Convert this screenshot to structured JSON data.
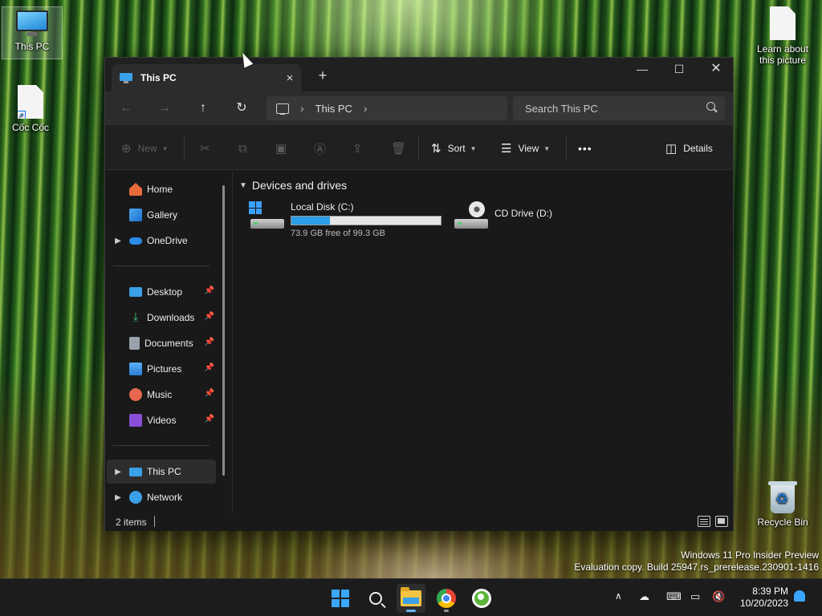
{
  "desktop": {
    "icons": {
      "this_pc": "This PC",
      "coc_coc": "Cốc Cốc",
      "learn_about": "Learn about this picture",
      "recycle_bin": "Recycle Bin"
    },
    "watermark": {
      "line1": "Windows 11 Pro Insider Preview",
      "line2": "Evaluation copy. Build 25947.rs_prerelease.230901-1416"
    }
  },
  "window": {
    "tab_title": "This PC",
    "tab_close_icon": "×",
    "new_tab_icon": "+",
    "controls": {
      "minimize": "—",
      "maximize": "☐",
      "close": "✕"
    },
    "nav": {
      "back": "←",
      "forward": "→",
      "up": "↑",
      "refresh": "↻"
    },
    "address": {
      "chevron": "›",
      "location": "This PC"
    },
    "search": {
      "placeholder": "Search This PC"
    },
    "toolbar": {
      "new_label": "New",
      "sort_label": "Sort",
      "view_label": "View",
      "more_label": "•••",
      "details_label": "Details"
    },
    "sidebar": {
      "home": "Home",
      "gallery": "Gallery",
      "onedrive": "OneDrive",
      "desktop": "Desktop",
      "downloads": "Downloads",
      "documents": "Documents",
      "pictures": "Pictures",
      "music": "Music",
      "videos": "Videos",
      "this_pc": "This PC",
      "network": "Network"
    },
    "content": {
      "group_title": "Devices and drives",
      "drives": [
        {
          "name": "Local Disk (C:)",
          "free_text": "73.9 GB free of 99.3 GB",
          "used_fraction": 0.256
        },
        {
          "name": "CD Drive (D:)"
        }
      ]
    },
    "status": {
      "items": "2 items"
    }
  },
  "taskbar": {
    "clock_time": "8:39 PM",
    "clock_date": "10/20/2023",
    "tray_chevron": "∧"
  },
  "colors": {
    "accent": "#3aa0e8",
    "window_bg": "#191919",
    "drive_bar_fill": "#2a9ee6"
  }
}
